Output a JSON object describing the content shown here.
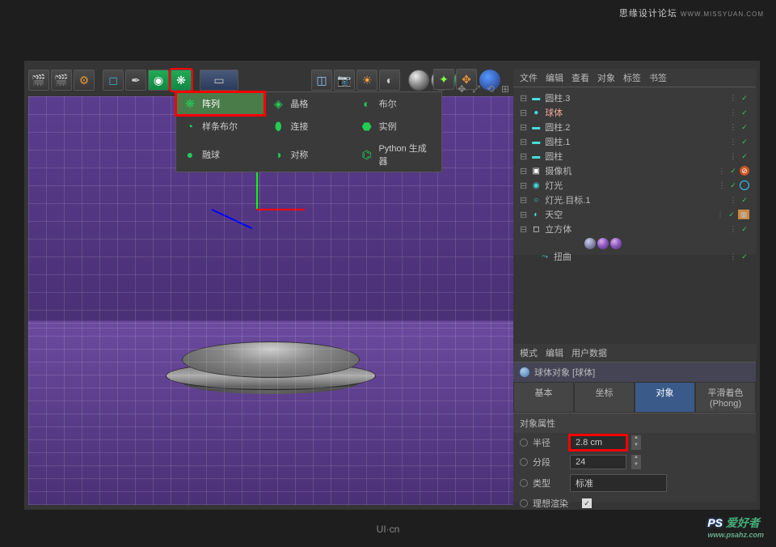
{
  "watermarks": {
    "top": "思缘设计论坛",
    "top_url": "WWW.MISSYUAN.COM",
    "bottom_center": "UI·cn",
    "bottom_right_ps": "PS",
    "bottom_right_text": " 爱好者",
    "bottom_right_url": "www.psahz.com"
  },
  "dropdown": {
    "items": [
      [
        "阵列",
        "晶格",
        "布尔"
      ],
      [
        "样条布尔",
        "连接",
        "实例"
      ],
      [
        "融球",
        "对称",
        "Python 生成器"
      ]
    ]
  },
  "om": {
    "menu": [
      "文件",
      "编辑",
      "查看",
      "对象",
      "标签",
      "书签"
    ],
    "items": [
      {
        "label": "圆柱.3",
        "icon": "cyl"
      },
      {
        "label": "球体",
        "icon": "sphere",
        "selected": true
      },
      {
        "label": "圆柱.2",
        "icon": "cyl"
      },
      {
        "label": "圆柱.1",
        "icon": "cyl"
      },
      {
        "label": "圆柱",
        "icon": "cyl"
      },
      {
        "label": "摄像机",
        "icon": "cam",
        "disabled": true
      },
      {
        "label": "灯光",
        "icon": "light",
        "target": true
      },
      {
        "label": "灯光.目标.1",
        "icon": "null"
      },
      {
        "label": "天空",
        "icon": "sky",
        "film": true
      },
      {
        "label": "立方体",
        "icon": "cube",
        "mats": true
      },
      {
        "label": "扭曲",
        "icon": "bend",
        "child": true
      }
    ]
  },
  "attr": {
    "menu": [
      "模式",
      "编辑",
      "用户数据"
    ],
    "title": "球体对象 [球体]",
    "tabs": [
      "基本",
      "坐标",
      "对象",
      "平滑着色(Phong)"
    ],
    "section": "对象属性",
    "rows": {
      "radius_label": "半径",
      "radius_value": "2.8 cm",
      "segments_label": "分段",
      "segments_value": "24",
      "type_label": "类型",
      "type_value": "标准",
      "render_label": "理想渲染"
    }
  }
}
